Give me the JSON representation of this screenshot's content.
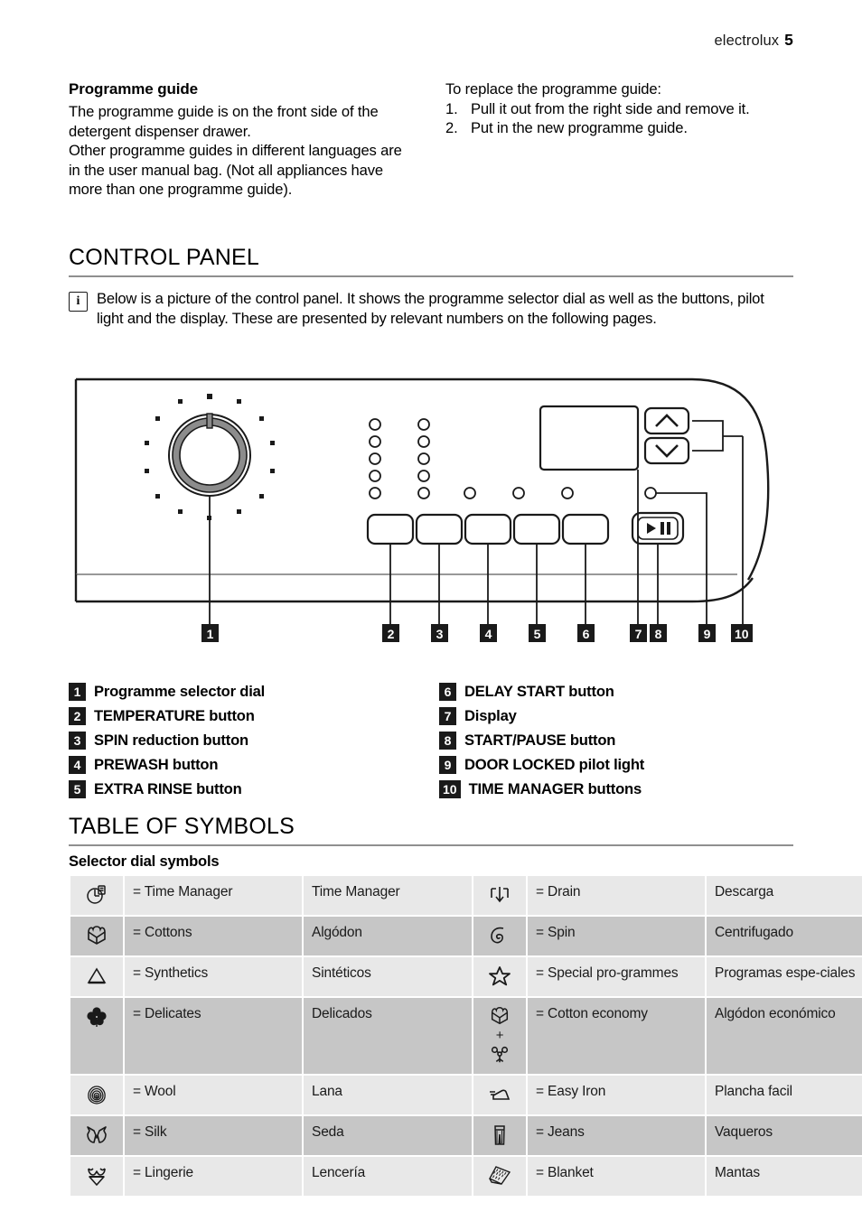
{
  "header": {
    "brand": "electrolux",
    "page_number": "5"
  },
  "intro": {
    "left": {
      "heading": "Programme guide",
      "paragraphs": [
        "The programme guide is on the front side of the detergent dispenser drawer.",
        "Other programme guides in different languages are in the user manual bag. (Not all appliances have more than one programme guide)."
      ]
    },
    "right": {
      "lead": "To replace the programme guide:",
      "steps": [
        {
          "n": "1.",
          "text": "Pull it out from the right side and remove it."
        },
        {
          "n": "2.",
          "text": "Put in the new programme guide."
        }
      ]
    }
  },
  "control_panel": {
    "title": "CONTROL PANEL",
    "note_icon": "i",
    "note": "Below is a picture of the control panel. It shows the programme selector dial as well as the buttons, pilot light and the display. These are presented by relevant numbers on the following pages.",
    "callouts": [
      "1",
      "2",
      "3",
      "4",
      "5",
      "6",
      "7",
      "8",
      "9",
      "10"
    ],
    "legend_left": [
      {
        "n": "1",
        "label": "Programme selector dial"
      },
      {
        "n": "2",
        "label": "TEMPERATURE button"
      },
      {
        "n": "3",
        "label": "SPIN reduction button"
      },
      {
        "n": "4",
        "label": "PREWASH button"
      },
      {
        "n": "5",
        "label": "EXTRA RINSE button"
      }
    ],
    "legend_right": [
      {
        "n": "6",
        "label": "DELAY START button"
      },
      {
        "n": "7",
        "label": "Display"
      },
      {
        "n": "8",
        "label": "START/PAUSE button"
      },
      {
        "n": "9",
        "label": "DOOR LOCKED pilot light"
      },
      {
        "n": "10",
        "label": "TIME MANAGER buttons"
      }
    ]
  },
  "table_of_symbols": {
    "title": "TABLE OF SYMBOLS",
    "subheading": "Selector dial symbols",
    "rows": [
      {
        "shade": "light",
        "left": {
          "icon": "time-manager-icon",
          "en": "= Time Manager",
          "es": "Time Manager"
        },
        "right": {
          "icon": "drain-icon",
          "en": "= Drain",
          "es": "Descarga"
        }
      },
      {
        "shade": "dark",
        "left": {
          "icon": "cottons-icon",
          "en": "= Cottons",
          "es": "Algódon"
        },
        "right": {
          "icon": "spin-icon",
          "en": "= Spin",
          "es": "Centrifugado"
        }
      },
      {
        "shade": "light",
        "left": {
          "icon": "synthetics-icon",
          "en": "= Synthetics",
          "es": "Sintéticos"
        },
        "right": {
          "icon": "star-icon",
          "en": "= Special pro-grammes",
          "es": "Programas espe-ciales"
        }
      },
      {
        "shade": "dark",
        "left": {
          "icon": "delicates-icon",
          "en": "= Delicates",
          "es": "Delicados"
        },
        "right": {
          "icon": "cotton-economy-icon",
          "en": "= Cotton economy",
          "es": "Algódon económico",
          "plus": "+"
        }
      },
      {
        "shade": "light",
        "left": {
          "icon": "wool-icon",
          "en": "= Wool",
          "es": "Lana"
        },
        "right": {
          "icon": "easy-iron-icon",
          "en": "= Easy Iron",
          "es": "Plancha facil"
        }
      },
      {
        "shade": "dark",
        "left": {
          "icon": "silk-icon",
          "en": "= Silk",
          "es": "Seda"
        },
        "right": {
          "icon": "jeans-icon",
          "en": "= Jeans",
          "es": "Vaqueros"
        }
      },
      {
        "shade": "light",
        "left": {
          "icon": "lingerie-icon",
          "en": "= Lingerie",
          "es": "Lencería"
        },
        "right": {
          "icon": "blanket-icon",
          "en": "= Blanket",
          "es": "Mantas"
        }
      }
    ]
  },
  "colors": {
    "rule": "#8f8f8f",
    "badge_bg": "#1a1a1a",
    "table_light": "#e8e8e8",
    "table_dark": "#c6c6c6"
  }
}
